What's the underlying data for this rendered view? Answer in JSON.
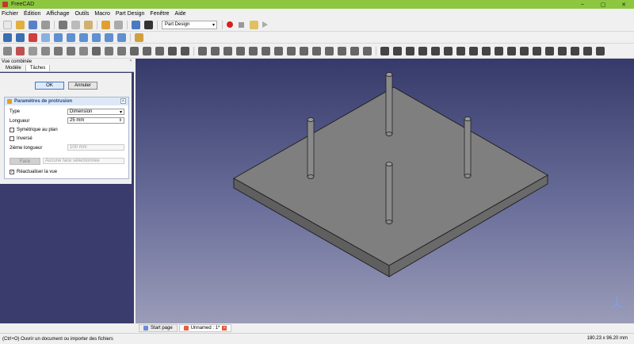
{
  "window": {
    "title": "FreeCAD",
    "min": "–",
    "max": "▢",
    "close": "✕"
  },
  "menu": [
    "Fichier",
    "Édition",
    "Affichage",
    "Outils",
    "Macro",
    "Part Design",
    "Fenêtre",
    "Aide"
  ],
  "toolbar": {
    "workbench": "Part Design"
  },
  "panel": {
    "title": "Vue combinée",
    "tabs": [
      "Modèle",
      "Tâches"
    ],
    "ok": "OK",
    "cancel": "Annuler",
    "task_title": "Paramètres de protrusion",
    "type_label": "Type",
    "type_value": "Dimension",
    "length_label": "Longueur",
    "length_value": "25 mm",
    "sym_label": "Symétrique au plan",
    "inverse_label": "Inversé",
    "second_length_label": "2ième longueur",
    "second_length_value": "100 mm",
    "face_button": "Face",
    "face_value": "Aucune face sélectionnée",
    "refresh_label": "Réactualiser la vue"
  },
  "doctabs": [
    "Start page",
    "Unnamed : 1*"
  ],
  "status": {
    "message": "(Ctrl+O) Ouvrir un document ou importer des fichiers",
    "dims": "180.23 x 96.20 mm"
  },
  "colors": {
    "titlebar": "#8dc63f",
    "panel_bg": "#3a3c6e",
    "accent": "#214a86"
  },
  "icons": [
    "new-icon",
    "open-icon",
    "save-icon",
    "undo-icon",
    "redo-icon",
    "refresh-icon",
    "record-macro-icon",
    "stop-macro-icon",
    "play-macro-icon",
    "fit-all-icon",
    "view-cube-icon",
    "sketch-icon",
    "pad-icon",
    "pocket-icon"
  ]
}
